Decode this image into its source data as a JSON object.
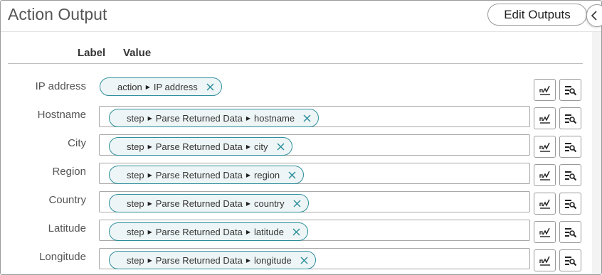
{
  "panel": {
    "title": "Action Output",
    "edit_label": "Edit Outputs"
  },
  "columns": {
    "label": "Label",
    "value": "Value"
  },
  "rows": [
    {
      "label": "IP address",
      "chip": {
        "source": "action",
        "path": [],
        "field": "IP address"
      }
    },
    {
      "label": "Hostname",
      "chip": {
        "source": "step",
        "path": [
          "Parse Returned Data"
        ],
        "field": "hostname"
      }
    },
    {
      "label": "City",
      "chip": {
        "source": "step",
        "path": [
          "Parse Returned Data"
        ],
        "field": "city"
      }
    },
    {
      "label": "Region",
      "chip": {
        "source": "step",
        "path": [
          "Parse Returned Data"
        ],
        "field": "region"
      }
    },
    {
      "label": "Country",
      "chip": {
        "source": "step",
        "path": [
          "Parse Returned Data"
        ],
        "field": "country"
      }
    },
    {
      "label": "Latitude",
      "chip": {
        "source": "step",
        "path": [
          "Parse Returned Data"
        ],
        "field": "latitude"
      }
    },
    {
      "label": "Longitude",
      "chip": {
        "source": "step",
        "path": [
          "Parse Returned Data"
        ],
        "field": "longitude"
      }
    }
  ],
  "icons": {
    "collapse": "chevron-left-icon",
    "remove": "close-icon",
    "edit_value": "edit-signature-icon",
    "pick_data": "data-picker-icon"
  },
  "colors": {
    "chip_border": "#2d8f9b",
    "chip_background": "#eef5f6",
    "remove_icon": "#2d8f9b"
  }
}
